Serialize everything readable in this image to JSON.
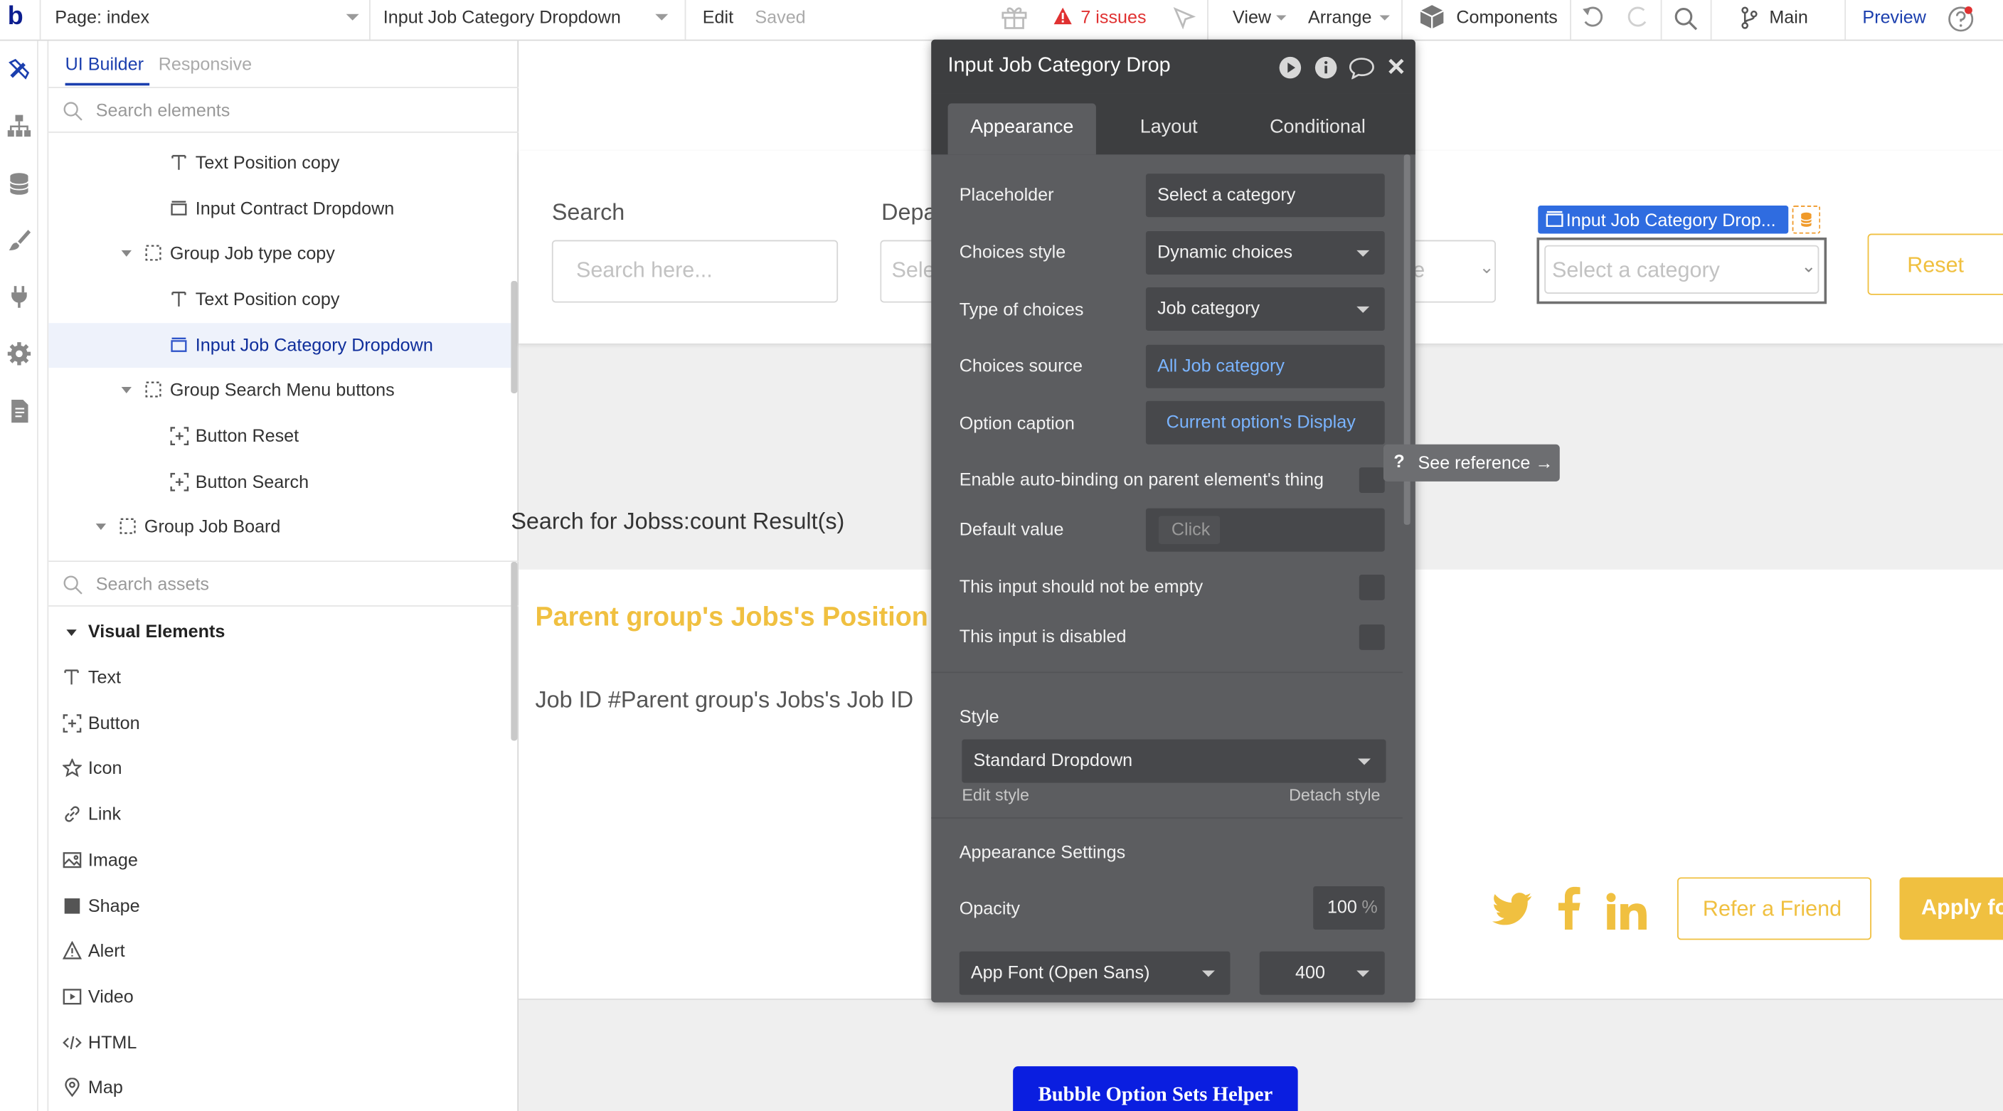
{
  "topbar": {
    "logo": "b",
    "page_selector": "Page: index",
    "element_selector": "Input Job Category Dropdown",
    "edit": "Edit",
    "saved": "Saved",
    "issues": "7 issues",
    "view": "View",
    "arrange": "Arrange",
    "components": "Components",
    "branch": "Main",
    "preview": "Preview"
  },
  "panel": {
    "tab_ui_builder": "UI Builder",
    "tab_responsive": "Responsive",
    "search_elements": "Search elements",
    "tree": [
      {
        "label": "Text Position copy",
        "icon": "text-icon"
      },
      {
        "label": "Input Contract Dropdown",
        "icon": "dropdown-icon"
      },
      {
        "label": "Group Job type copy",
        "icon": "group-icon"
      },
      {
        "label": "Text Position copy",
        "icon": "text-icon"
      },
      {
        "label": "Input Job Category Dropdown",
        "icon": "dropdown-icon"
      },
      {
        "label": "Group Search Menu buttons",
        "icon": "group-icon"
      },
      {
        "label": "Button Reset",
        "icon": "button-icon"
      },
      {
        "label": "Button Search",
        "icon": "button-icon"
      },
      {
        "label": "Group Job Board",
        "icon": "group-icon"
      }
    ],
    "search_assets": "Search assets",
    "visual_elements": "Visual Elements",
    "assets": [
      {
        "label": "Text",
        "icon": "text-icon"
      },
      {
        "label": "Button",
        "icon": "button-icon"
      },
      {
        "label": "Icon",
        "icon": "star-icon"
      },
      {
        "label": "Link",
        "icon": "link-icon"
      },
      {
        "label": "Image",
        "icon": "image-icon"
      },
      {
        "label": "Shape",
        "icon": "shape-icon"
      },
      {
        "label": "Alert",
        "icon": "alert-icon"
      },
      {
        "label": "Video",
        "icon": "video-icon"
      },
      {
        "label": "HTML",
        "icon": "html-icon"
      },
      {
        "label": "Map",
        "icon": "map-pin-icon"
      }
    ]
  },
  "canvas": {
    "search_label": "Search",
    "search_placeholder": "Search here...",
    "department_label": "Depa",
    "department_placeholder": "Sele",
    "dropdown_tag": "Input Job Category Drop...",
    "dropdown_placeholder": "Select a category",
    "reset_button": "Reset",
    "results_heading": "Search for Jobss:count Result(s)",
    "job_position": "Parent group's Jobs's Position",
    "job_id": "Job ID #Parent group's Jobs's Job ID",
    "refer_button": "Refer a Friend",
    "apply_button": "Apply fo",
    "helper_button": "Bubble Option Sets Helper",
    "accent_color": "#f0c040",
    "helper_color": "#0a1ee0"
  },
  "editor": {
    "title": "Input Job Category Drop",
    "tabs": [
      "Appearance",
      "Layout",
      "Conditional"
    ],
    "placeholder_label": "Placeholder",
    "placeholder_value": "Select a category",
    "choices_style_label": "Choices style",
    "choices_style_value": "Dynamic choices",
    "type_label": "Type of choices",
    "type_value": "Job category",
    "source_label": "Choices source",
    "source_value": "All Job category",
    "caption_label": "Option caption",
    "caption_value": "Current option's Display",
    "autobind_label": "Enable auto-binding on parent element's thing",
    "default_label": "Default value",
    "default_value": "Click",
    "not_empty_label": "This input should not be empty",
    "disabled_label": "This input is disabled",
    "style_heading": "Style",
    "style_value": "Standard Dropdown",
    "edit_style": "Edit style",
    "detach_style": "Detach style",
    "appearance_settings": "Appearance Settings",
    "opacity_label": "Opacity",
    "opacity_value": "100",
    "opacity_unit": "%",
    "font_value": "App Font (Open Sans)",
    "weight_value": "400",
    "link_color": "#7ab4ff"
  },
  "tooltip": {
    "text": "See reference →",
    "q": "?"
  }
}
